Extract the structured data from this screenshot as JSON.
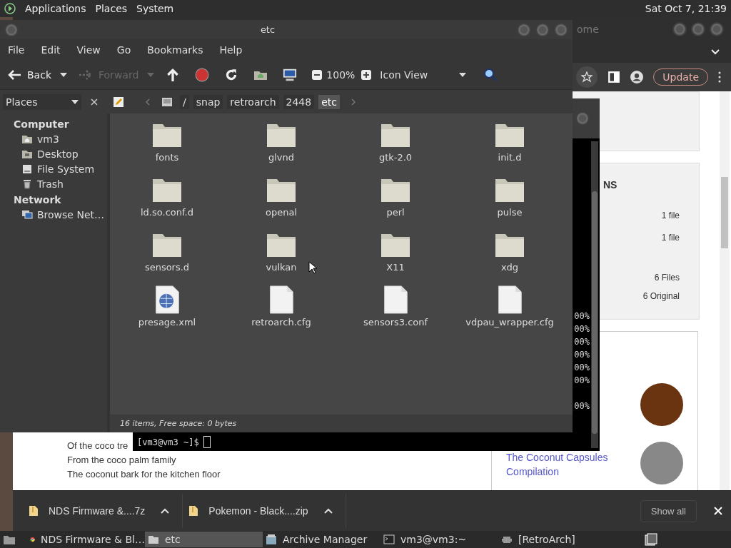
{
  "top_panel": {
    "menus": [
      "Applications",
      "Places",
      "System"
    ],
    "clock": "Sat Oct 7, 21:39"
  },
  "browser": {
    "title_fragment": "ome",
    "update_button": "Update",
    "heading_fragment": "NS",
    "stats": [
      "1 file",
      "1 file",
      "6 Files",
      "6 Original"
    ],
    "lyrics": [
      "Of the coco tre",
      "From the coco palm family",
      "The coconut bark for the kitchen floor"
    ],
    "link_lines": [
      "The Coconut Capsules",
      "Compilation"
    ]
  },
  "downloads": [
    {
      "name": "NDS Firmware &....7z"
    },
    {
      "name": "Pokemon - Black....zip"
    }
  ],
  "show_all": "Show all",
  "terminal": {
    "prompt": "[vm3@vm3 ~]$",
    "progress": [
      "00%",
      "00%",
      "00%",
      "00%",
      "00%",
      "00%",
      "00%"
    ]
  },
  "file_manager": {
    "title": "etc",
    "menu": [
      "File",
      "Edit",
      "View",
      "Go",
      "Bookmarks",
      "Help"
    ],
    "toolbar": {
      "back": {
        "label": "Back",
        "disabled": false
      },
      "forward": {
        "label": "Forward",
        "disabled": true
      },
      "zoom": "100%",
      "view": "Icon View"
    },
    "sidebar": {
      "header": "Places",
      "sections": [
        {
          "title": "Computer",
          "items": [
            {
              "label": "vm3",
              "kind": "home"
            },
            {
              "label": "Desktop",
              "kind": "desktop"
            },
            {
              "label": "File System",
              "kind": "drive"
            },
            {
              "label": "Trash",
              "kind": "trash"
            }
          ]
        },
        {
          "title": "Network",
          "items": [
            {
              "label": "Browse Net…",
              "kind": "network"
            }
          ]
        }
      ]
    },
    "breadcrumb": [
      {
        "label": "/",
        "selected": false
      },
      {
        "label": "snap",
        "selected": false
      },
      {
        "label": "retroarch",
        "selected": false
      },
      {
        "label": "2448",
        "selected": false
      },
      {
        "label": "etc",
        "selected": true
      }
    ],
    "items": [
      {
        "name": "fonts",
        "kind": "folder"
      },
      {
        "name": "glvnd",
        "kind": "folder"
      },
      {
        "name": "gtk-2.0",
        "kind": "folder"
      },
      {
        "name": "init.d",
        "kind": "folder"
      },
      {
        "name": "ld.so.conf.d",
        "kind": "folder"
      },
      {
        "name": "openal",
        "kind": "folder"
      },
      {
        "name": "perl",
        "kind": "folder"
      },
      {
        "name": "pulse",
        "kind": "folder"
      },
      {
        "name": "sensors.d",
        "kind": "folder"
      },
      {
        "name": "vulkan",
        "kind": "folder"
      },
      {
        "name": "X11",
        "kind": "folder"
      },
      {
        "name": "xdg",
        "kind": "folder"
      },
      {
        "name": "presage.xml",
        "kind": "xml"
      },
      {
        "name": "retroarch.cfg",
        "kind": "file"
      },
      {
        "name": "sensors3.conf",
        "kind": "file"
      },
      {
        "name": "vdpau_wrapper.cfg",
        "kind": "file"
      }
    ],
    "status": "16 items, Free space: 0 bytes"
  },
  "taskbar": [
    {
      "label": "NDS Firmware & Bl…",
      "kind": "browser",
      "selected": false
    },
    {
      "label": "etc",
      "kind": "folder",
      "selected": true
    },
    {
      "label": "Archive Manager",
      "kind": "archive",
      "selected": false
    },
    {
      "label": "vm3@vm3:~",
      "kind": "terminal",
      "selected": false
    },
    {
      "label": "[RetroArch]",
      "kind": "game",
      "selected": false
    }
  ]
}
